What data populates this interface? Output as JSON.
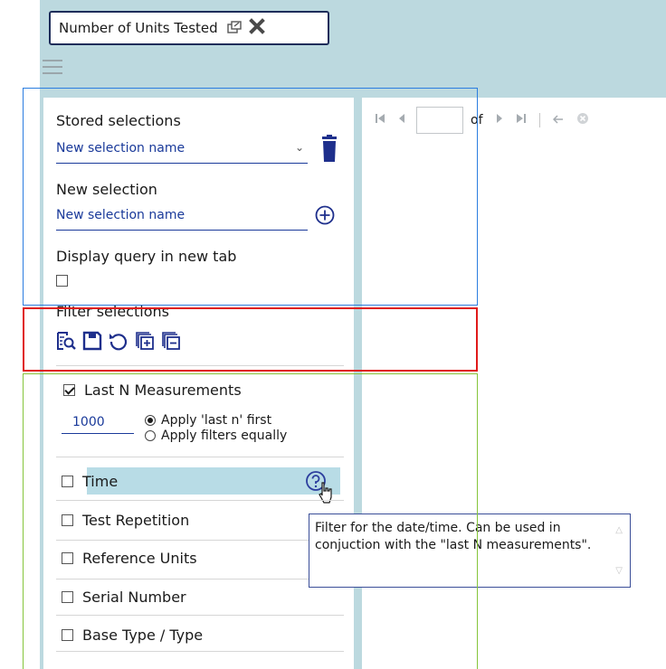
{
  "tab": {
    "title": "Number of Units Tested",
    "popout_icon": "popout-icon",
    "close_icon": "close-icon"
  },
  "menu_icon": "hamburger-icon",
  "pager": {
    "of_label": "of",
    "page_value": ""
  },
  "stored": {
    "title": "Stored selections",
    "placeholder": "New selection name",
    "delete_icon": "trash-icon"
  },
  "new_selection": {
    "title": "New selection",
    "placeholder": "New selection name",
    "add_icon": "plus-circle-icon"
  },
  "display_query": {
    "label": "Display query in new tab",
    "checked": false
  },
  "filter_selections": {
    "title": "Filter selections",
    "icons": [
      "search-filter-icon",
      "save-icon",
      "reset-icon",
      "add-copy-icon",
      "remove-copy-icon"
    ]
  },
  "last_n": {
    "label": "Last N Measurements",
    "checked": true,
    "value": "1000",
    "options": [
      {
        "label": "Apply 'last n' first",
        "selected": true
      },
      {
        "label": "Apply filters equally",
        "selected": false
      }
    ]
  },
  "filters": [
    {
      "label": "Time",
      "checked": false,
      "highlighted": true
    },
    {
      "label": "Test Repetition",
      "checked": false
    },
    {
      "label": "Reference Units",
      "checked": false
    },
    {
      "label": "Serial Number",
      "checked": false
    },
    {
      "label": "Base Type / Type",
      "checked": false
    }
  ],
  "tooltip": {
    "text": "Filter for the date/time. Can be used in conjuction with the \"last N measurements\"."
  },
  "colors": {
    "accent": "#1a3a9a",
    "highlight": "#b8dce6",
    "page_bg": "#bcd9df"
  }
}
